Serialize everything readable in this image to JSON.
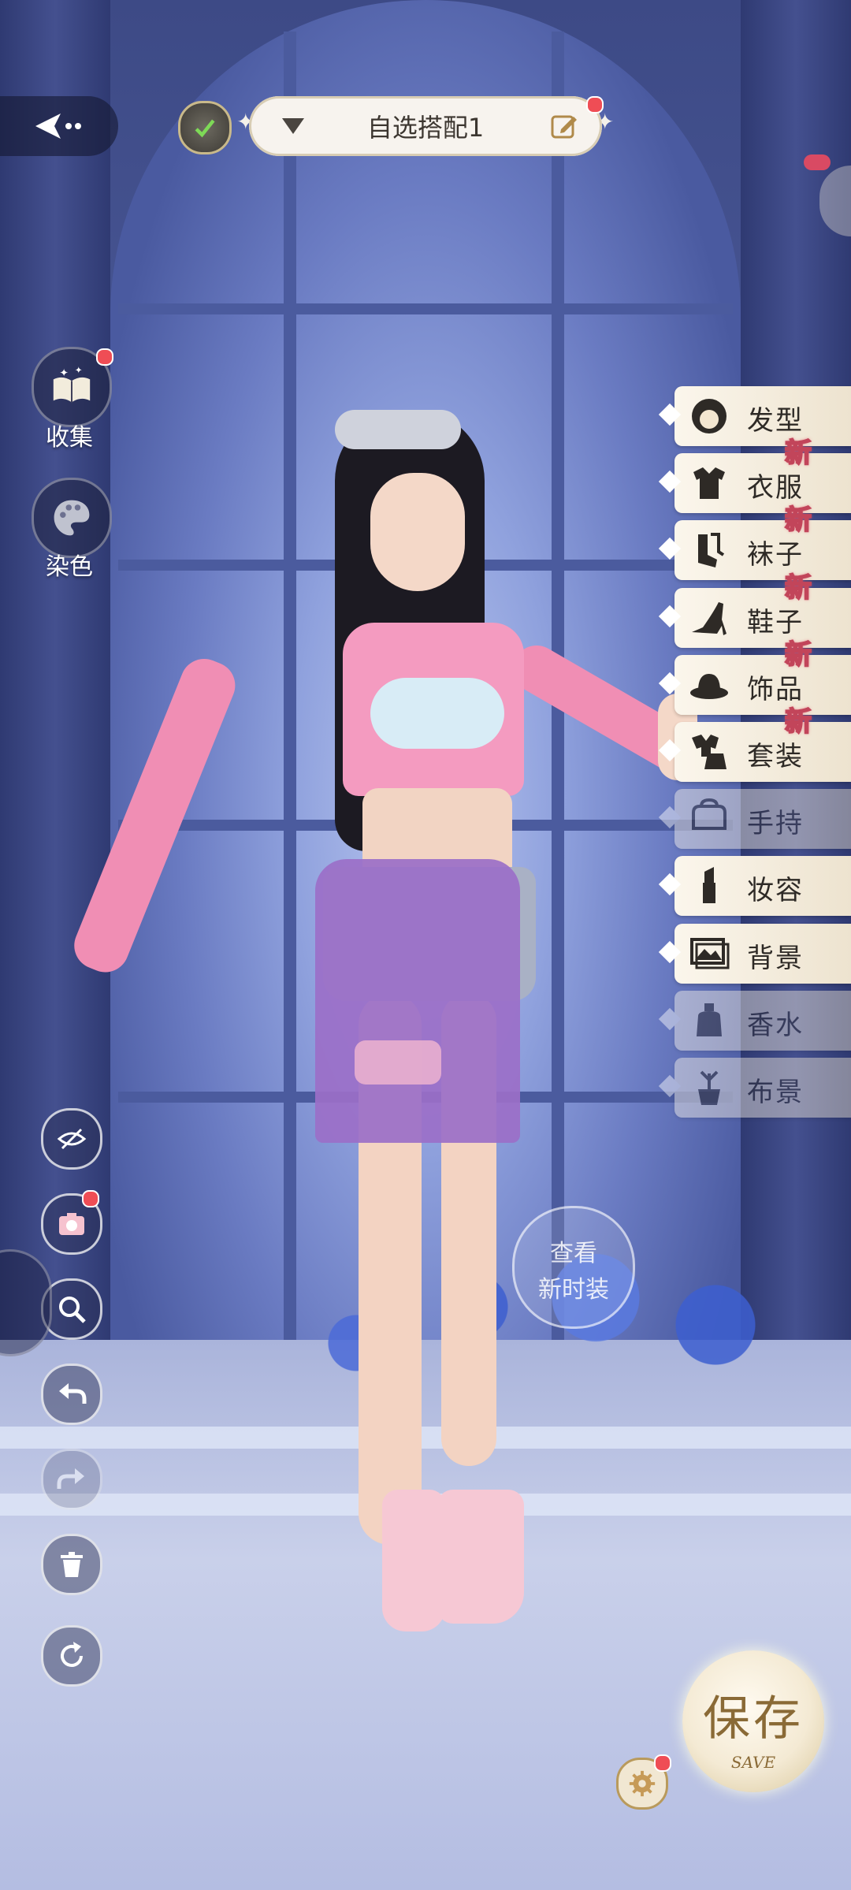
{
  "header": {
    "outfit_name": "自选搭配1"
  },
  "left_menu": {
    "collect_label": "收集",
    "dye_label": "染色"
  },
  "categories": [
    {
      "label": "发型",
      "icon": "hair-icon",
      "new": false,
      "dim": false
    },
    {
      "label": "衣服",
      "icon": "clothes-icon",
      "new": true,
      "dim": false
    },
    {
      "label": "袜子",
      "icon": "socks-icon",
      "new": true,
      "dim": false
    },
    {
      "label": "鞋子",
      "icon": "shoes-icon",
      "new": true,
      "dim": false
    },
    {
      "label": "饰品",
      "icon": "accessory-icon",
      "new": true,
      "dim": false
    },
    {
      "label": "套装",
      "icon": "set-icon",
      "new": true,
      "dim": false
    },
    {
      "label": "手持",
      "icon": "handheld-icon",
      "new": false,
      "dim": true
    },
    {
      "label": "妆容",
      "icon": "lipstick-icon",
      "new": false,
      "dim": false
    },
    {
      "label": "背景",
      "icon": "background-icon",
      "new": false,
      "dim": false
    },
    {
      "label": "香水",
      "icon": "perfume-icon",
      "new": false,
      "dim": true
    },
    {
      "label": "布景",
      "icon": "scenery-icon",
      "new": false,
      "dim": true
    }
  ],
  "new_badge": "新",
  "view_badge": {
    "line1": "查看",
    "line2": "新时装"
  },
  "save": {
    "main": "保存",
    "sub": "SAVE"
  },
  "colors": {
    "accent_red": "#ef4d55",
    "pill_bg": "#f7f3ee",
    "button_gold": "#8a6a36"
  }
}
